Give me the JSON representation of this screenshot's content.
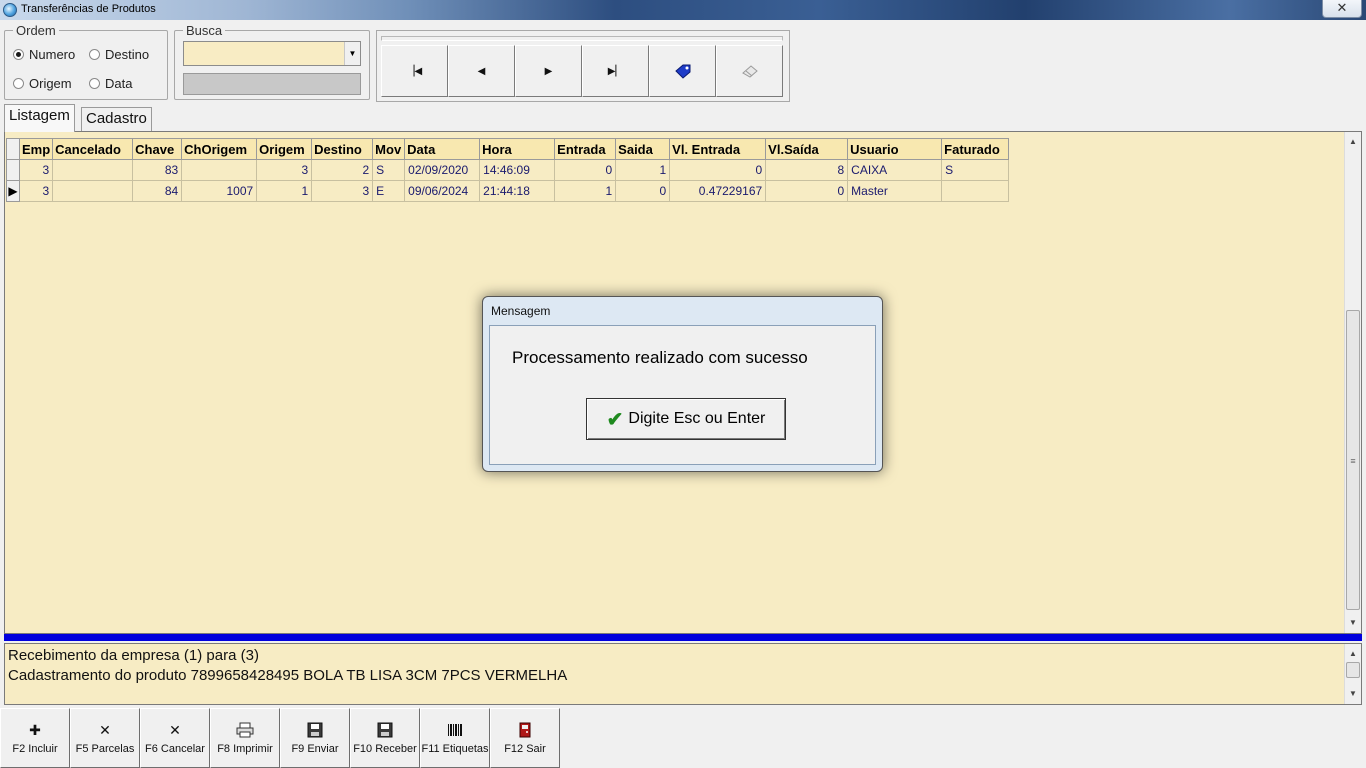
{
  "window": {
    "title": "Transferências de Produtos",
    "close_glyph": "✕"
  },
  "ordem": {
    "legend": "Ordem",
    "options": [
      {
        "label": "Numero",
        "selected": true
      },
      {
        "label": "Destino",
        "selected": false
      },
      {
        "label": "Origem",
        "selected": false
      },
      {
        "label": "Data",
        "selected": false
      }
    ]
  },
  "busca": {
    "legend": "Busca",
    "value": "",
    "secondary_value": ""
  },
  "nav": {
    "buttons": [
      {
        "name": "first",
        "glyph": "|◀"
      },
      {
        "name": "prior",
        "glyph": "◀"
      },
      {
        "name": "next",
        "glyph": "▶"
      },
      {
        "name": "last",
        "glyph": "▶|"
      },
      {
        "name": "post",
        "glyph": "tag-icon"
      },
      {
        "name": "cancel",
        "glyph": "eraser-icon"
      }
    ]
  },
  "tabs": [
    {
      "label": "Listagem",
      "active": true
    },
    {
      "label": "Cadastro",
      "active": false
    }
  ],
  "grid": {
    "columns": [
      "Emp",
      "Cancelado",
      "Chave",
      "ChOrigem",
      "Origem",
      "Destino",
      "Mov",
      "Data",
      "Hora",
      "Entrada",
      "Saida",
      "Vl. Entrada",
      "Vl.Saída",
      "Usuario",
      "Faturado"
    ],
    "rows": [
      [
        "3",
        "",
        "83",
        "",
        "3",
        "2",
        "S",
        "02/09/2020",
        "14:46:09",
        "0",
        "1",
        "0",
        "8",
        "CAIXA",
        "S"
      ],
      [
        "3",
        "",
        "84",
        "1007",
        "1",
        "3",
        "E",
        "09/06/2024",
        "21:44:18",
        "1",
        "0",
        "0.47229167",
        "0",
        "Master",
        ""
      ]
    ],
    "current_row": 1
  },
  "memo": {
    "lines": [
      "Recebimento da empresa (1) para (3)",
      "Cadastramento do produto 7899658428495 BOLA TB LISA 3CM 7PCS VERMELHA"
    ]
  },
  "function_buttons": [
    {
      "label": "F2 Incluir",
      "icon": "plus-icon"
    },
    {
      "label": "F5 Parcelas",
      "icon": "x-icon"
    },
    {
      "label": "F6 Cancelar",
      "icon": "x-icon"
    },
    {
      "label": "F8 Imprimir",
      "icon": "printer-icon"
    },
    {
      "label": "F9 Enviar",
      "icon": "floppy-icon"
    },
    {
      "label": "F10 Receber",
      "icon": "floppy-icon"
    },
    {
      "label": "F11 Etiquetas",
      "icon": "barcode-icon"
    },
    {
      "label": "F12 Sair",
      "icon": "exit-door-icon"
    }
  ],
  "dialog": {
    "title": "Mensagem",
    "message": "Processamento realizado com sucesso",
    "button_label": "Digite Esc ou Enter"
  }
}
